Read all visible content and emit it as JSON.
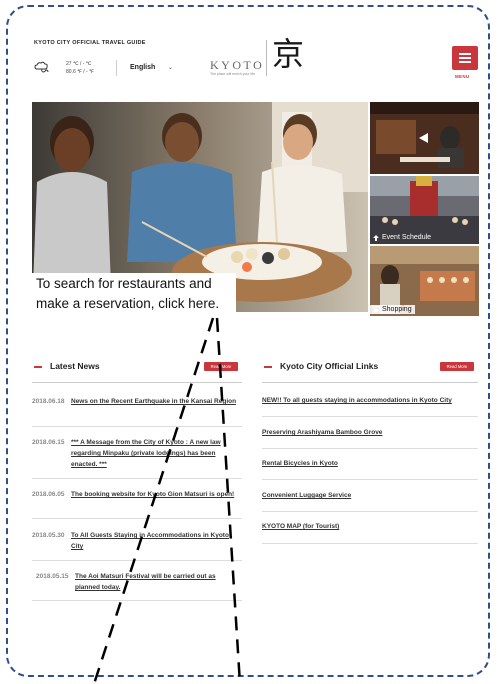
{
  "header": {
    "guide_title": "KYOTO CITY OFFICIAL TRAVEL GUIDE",
    "temp_c": "27 ℃ / - ℃",
    "temp_f": "80.6 ℉ / - ℉",
    "language": "English",
    "logo_text": "KYOTO",
    "logo_tagline": "The place will enrich your life",
    "logo_kanji": "京",
    "menu_label": "MENU"
  },
  "hero": {
    "caption": "To search for restaurants and make a reservation, click here."
  },
  "side_panels": [
    {
      "label": ""
    },
    {
      "label": "Event Schedule"
    },
    {
      "label": "Shopping"
    }
  ],
  "latest_news": {
    "title": "Latest News",
    "more": "Read More",
    "items": [
      {
        "date": "2018.06.18",
        "text": "News on the Recent Earthquake in the Kansai Region"
      },
      {
        "date": "2018.06.15",
        "text": "*** A Message from the City of Kyoto : A new law regarding Minpaku (private lodgings) has been enacted. ***"
      },
      {
        "date": "2018.06.05",
        "text": "The booking website for Kyoto Gion Matsuri is open!"
      },
      {
        "date": "2018.05.30",
        "text": "To All Guests Staying in Accommodations in Kyoto City"
      },
      {
        "date": "2018.05.15",
        "text": "The Aoi Matsuri Festival will be carried out as planned today."
      }
    ]
  },
  "official_links": {
    "title": "Kyoto City Official Links",
    "more": "Read More",
    "items": [
      {
        "text": "NEW!! To all guests staying in accommodations in Kyoto City"
      },
      {
        "text": "Preserving Arashiyama Bamboo Grove"
      },
      {
        "text": "Rental Bicycles in Kyoto"
      },
      {
        "text": "Convenient Luggage Service"
      },
      {
        "text": "KYOTO MAP (for Tourist)"
      }
    ]
  },
  "colors": {
    "accent": "#c9373c",
    "frame": "#2f4e8a"
  }
}
